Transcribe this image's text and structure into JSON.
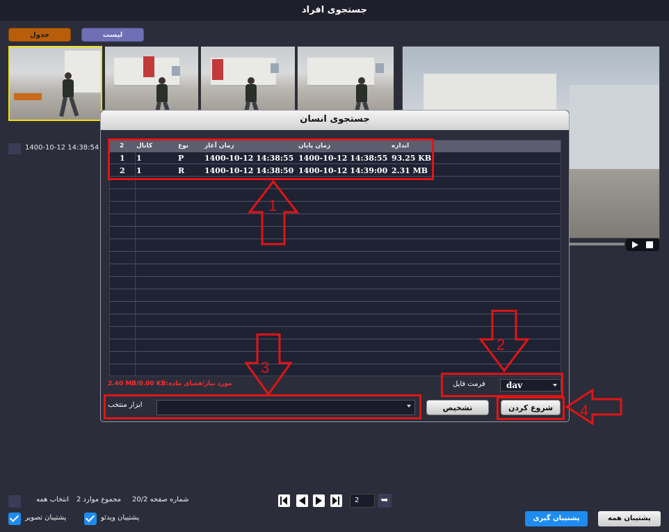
{
  "window": {
    "title": "جستجوی افراد"
  },
  "tabs": {
    "table": "جدول",
    "list": "لیست"
  },
  "thumbnail": {
    "timestamp": "1400-10-12 14:38:54"
  },
  "dialog": {
    "title": "جستجوی انسان",
    "table": {
      "headers": [
        "2",
        "کانال",
        "نوع",
        "زمان آغاز",
        "زمان پایان",
        "اندازه"
      ],
      "rows": [
        [
          "1",
          "1",
          "P",
          "1400-10-12 14:38:55",
          "1400-10-12 14:38:55",
          "93.25 KB"
        ],
        [
          "2",
          "1",
          "R",
          "1400-10-12 14:38:50",
          "1400-10-12 14:39:00",
          "2.31 MB"
        ]
      ]
    },
    "used_space": "2.40 MB/0.00 KB:مورد نیاز/فضای ماده",
    "file_format": {
      "label": "فرمت فایل",
      "value": "dav"
    },
    "tools": {
      "label": "ابزار منتخب",
      "value": ""
    },
    "diagnose_label": "تشخیص",
    "start_label": "شروع کردن"
  },
  "annotations": {
    "n1": "1",
    "n2": "2",
    "n3": "3",
    "n4": "4"
  },
  "footer": {
    "select_all": "انتخاب همه",
    "total_items": "2 مجموع موارد",
    "page_label": "20/2 شماره صفحه",
    "page_input": "2",
    "backup_video": "پشتیبان ویدئو",
    "backup_image": "پشتیبان تصویر",
    "backup_tagged": "پشتیبان گیری",
    "backup_all": "پشتیبان همه"
  },
  "colors": {
    "accent": "#1e8bf0",
    "annotation": "#e01515",
    "table_tab": "#b85e0a",
    "list_tab": "#6f6fb5"
  }
}
